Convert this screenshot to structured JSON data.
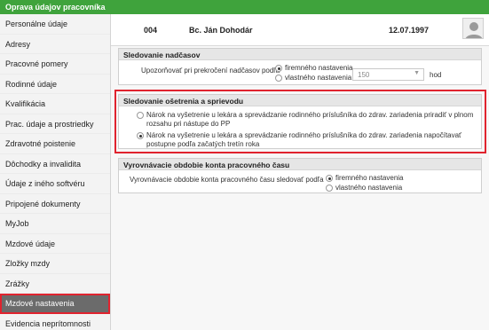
{
  "window": {
    "title": "Oprava údajov pracovníka"
  },
  "sidebar": {
    "items": [
      {
        "label": "Personálne údaje"
      },
      {
        "label": "Adresy"
      },
      {
        "label": "Pracovné pomery"
      },
      {
        "label": "Rodinné údaje"
      },
      {
        "label": "Kvalifikácia"
      },
      {
        "label": "Prac. údaje a prostriedky"
      },
      {
        "label": "Zdravotné poistenie"
      },
      {
        "label": "Dôchodky a invalidita"
      },
      {
        "label": "Údaje z iného softvéru"
      },
      {
        "label": "Pripojené dokumenty"
      },
      {
        "label": "MyJob"
      },
      {
        "label": "Mzdové údaje"
      },
      {
        "label": "Zložky mzdy"
      },
      {
        "label": "Zrážky"
      },
      {
        "label": "Mzdové nastavenia"
      },
      {
        "label": "Evidencia neprítomnosti"
      }
    ],
    "active_index": 14
  },
  "header": {
    "employee_id": "004",
    "employee_name": "Bc. Ján Dohodár",
    "date": "12.07.1997",
    "avatar_icon": "user-silhouette-icon"
  },
  "overtime": {
    "title": "Sledovanie nadčasov",
    "label": "Upozorňovať pri prekročení nadčasov podľa",
    "options": [
      "firemného nastavenia",
      "vlastného nastavenia"
    ],
    "selected": 0,
    "hours_value": "150",
    "unit": "hod"
  },
  "care": {
    "title": "Sledovanie ošetrenia a sprievodu",
    "options": [
      "Nárok na vyšetrenie u lekára a sprevádzanie rodinného príslušníka do zdrav. zariadenia priradiť v plnom rozsahu pri nástupe do PP",
      "Nárok na vyšetrenie u lekára a sprevádzanie rodinného príslušníka do zdrav. zariadenia napočítavať postupne podľa začatých tretín roka"
    ],
    "selected": 1
  },
  "balance": {
    "title": "Vyrovnávacie obdobie konta pracovného času",
    "label": "Vyrovnávacie obdobie konta pracovného času sledovať podľa",
    "options": [
      "firemného nastavenia",
      "vlastného nastavenia"
    ],
    "selected": 0
  },
  "colors": {
    "titlebar": "#3fa33c",
    "highlight": "#e0232e",
    "active_item": "#6b6b6b"
  }
}
